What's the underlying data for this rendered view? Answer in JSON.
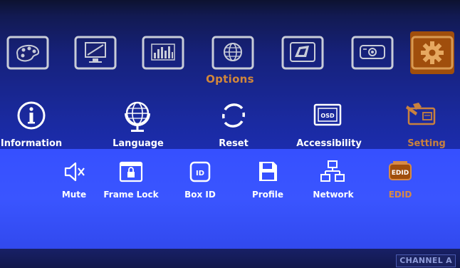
{
  "top_tiles": [
    {
      "name": "color-palette-icon",
      "active": false
    },
    {
      "name": "display-adjust-icon",
      "active": false
    },
    {
      "name": "equalizer-icon",
      "active": false
    },
    {
      "name": "globe-screen-icon",
      "active": false
    },
    {
      "name": "3d-icon",
      "active": false
    },
    {
      "name": "projector-icon",
      "active": false
    },
    {
      "name": "gear-icon",
      "active": true
    }
  ],
  "options_title": "Options",
  "menu": [
    {
      "label": "Information",
      "icon": "info-icon",
      "active": false
    },
    {
      "label": "Language",
      "icon": "globe-icon",
      "active": false
    },
    {
      "label": "Reset",
      "icon": "reset-icon",
      "active": false
    },
    {
      "label": "Accessibility",
      "icon": "osd-icon",
      "active": false
    },
    {
      "label": "Setting",
      "icon": "setting-icon",
      "active": true
    }
  ],
  "submenu": [
    {
      "label": "Mute",
      "icon": "mute-icon",
      "active": false
    },
    {
      "label": "Frame Lock",
      "icon": "frame-lock-icon",
      "active": false
    },
    {
      "label": "Box ID",
      "icon": "box-id-icon",
      "active": false
    },
    {
      "label": "Profile",
      "icon": "save-icon",
      "active": false
    },
    {
      "label": "Network",
      "icon": "network-icon",
      "active": false
    },
    {
      "label": "EDID",
      "icon": "edid-icon",
      "active": true
    }
  ],
  "osd_badge": "OSD",
  "id_badge": "ID",
  "edid_badge": "EDID",
  "channel_badge": "CHANNEL A",
  "colors": {
    "active_orange": "#c9813e",
    "panel_blue": "#3650ff",
    "tile_outline": "#c8ccd8"
  }
}
